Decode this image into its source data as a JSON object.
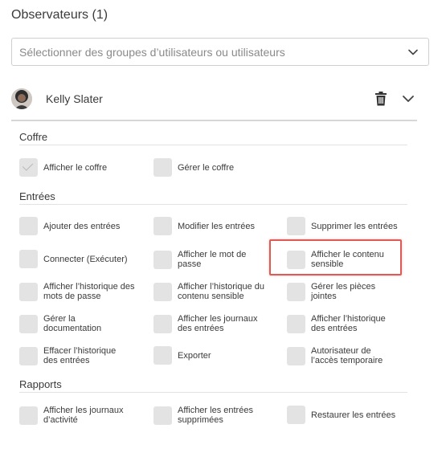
{
  "header": {
    "title": "Observateurs (1)"
  },
  "select": {
    "placeholder": "Sélectionner des groupes d’utilisateurs ou utilisateurs"
  },
  "user": {
    "name": "Kelly Slater"
  },
  "sections": [
    {
      "title": "Coffre",
      "items": [
        {
          "label": "Afficher le coffre",
          "checked": true
        },
        {
          "label": "Gérer le coffre",
          "checked": false
        }
      ]
    },
    {
      "title": "Entrées",
      "items": [
        {
          "label": "Ajouter des entrées",
          "checked": false
        },
        {
          "label": "Modifier les entrées",
          "checked": false
        },
        {
          "label": "Supprimer les entrées",
          "checked": false
        },
        {
          "label": "Connecter (Exécuter)",
          "checked": false
        },
        {
          "label": "Afficher le mot de passe",
          "checked": false
        },
        {
          "label": "Afficher le contenu sensible",
          "checked": false,
          "highlighted": true
        },
        {
          "label": "Afficher l’historique des mots de passe",
          "checked": false
        },
        {
          "label": "Afficher l’historique du contenu sensible",
          "checked": false
        },
        {
          "label": "Gérer les pièces jointes",
          "checked": false
        },
        {
          "label": "Gérer la documentation",
          "checked": false
        },
        {
          "label": "Afficher les journaux des entrées",
          "checked": false
        },
        {
          "label": "Afficher l’historique des entrées",
          "checked": false
        },
        {
          "label": "Effacer l’historique des entrées",
          "checked": false
        },
        {
          "label": "Exporter",
          "checked": false
        },
        {
          "label": "Autorisateur de l’accès temporaire",
          "checked": false
        }
      ]
    },
    {
      "title": "Rapports",
      "items": [
        {
          "label": "Afficher les journaux d’activité",
          "checked": false
        },
        {
          "label": "Afficher les entrées supprimées",
          "checked": false
        },
        {
          "label": "Restaurer les entrées",
          "checked": false
        }
      ]
    }
  ],
  "colors": {
    "highlight": "#e05a55",
    "checkbox": "#e3e3e3"
  },
  "icons": {
    "dropdown": "chevron-down-icon",
    "delete": "trash-icon",
    "expand": "chevron-down-icon"
  }
}
